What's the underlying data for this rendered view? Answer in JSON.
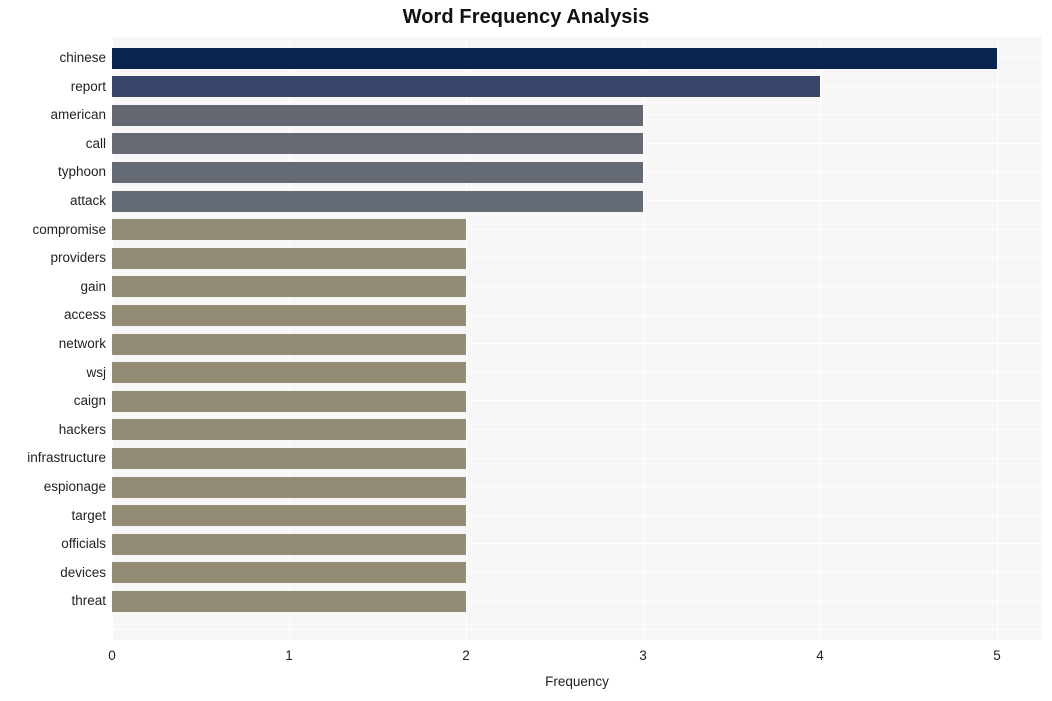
{
  "chart_data": {
    "type": "bar",
    "orientation": "horizontal",
    "title": "Word Frequency Analysis",
    "xlabel": "Frequency",
    "ylabel": "",
    "xlim": [
      0,
      5
    ],
    "grid": true,
    "legend": null,
    "x_ticks": [
      "0",
      "1",
      "2",
      "3",
      "4",
      "5"
    ],
    "categories": [
      "chinese",
      "report",
      "american",
      "call",
      "typhoon",
      "attack",
      "compromise",
      "providers",
      "gain",
      "access",
      "network",
      "wsj",
      "caign",
      "hackers",
      "infrastructure",
      "espionage",
      "target",
      "officials",
      "devices",
      "threat"
    ],
    "values": [
      5,
      4,
      3,
      3,
      3,
      3,
      2,
      2,
      2,
      2,
      2,
      2,
      2,
      2,
      2,
      2,
      2,
      2,
      2,
      2
    ],
    "bar_colors": [
      "#0a2450",
      "#39456b",
      "#646870",
      "#656a73",
      "#646a74",
      "#646a76",
      "#948d76",
      "#948d76",
      "#948d76",
      "#948d76",
      "#948d76",
      "#948d76",
      "#948d76",
      "#948d76",
      "#948d76",
      "#948d76",
      "#948d76",
      "#948d76",
      "#948d76",
      "#948d76"
    ],
    "plot_background": "#f7f7f7",
    "gridline_color": "#ffffff",
    "figure_background": "#ffffff"
  }
}
